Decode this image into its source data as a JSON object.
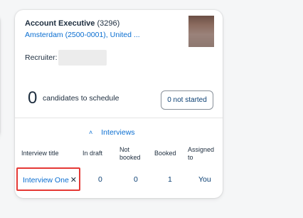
{
  "job": {
    "title": "Account Executive",
    "req_id": "(3296)",
    "location": "Amsterdam (2500-0001), United ..."
  },
  "recruiter": {
    "label": "Recruiter:"
  },
  "schedule": {
    "count": "0",
    "label": "candidates to schedule",
    "not_started_button": "0 not started"
  },
  "interviews": {
    "toggle_label": "Interviews",
    "toggle_icon": "chevron-up-icon",
    "columns": {
      "title": "Interview title",
      "in_draft": "In draft",
      "not_booked": "Not booked",
      "booked": "Booked",
      "assigned_to": "Assigned to"
    },
    "rows": [
      {
        "title": "Interview One",
        "in_draft": "0",
        "not_booked": "0",
        "booked": "1",
        "assigned_to": "You"
      }
    ]
  },
  "colors": {
    "link": "#0a6ed1",
    "text": "#1d2d3e",
    "highlight": "#e53935"
  }
}
